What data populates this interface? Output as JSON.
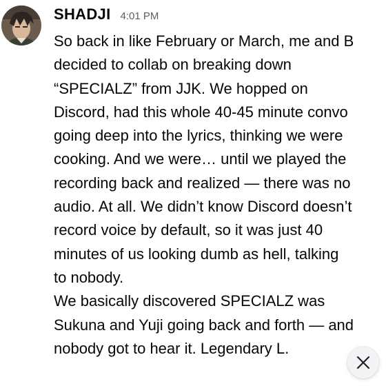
{
  "message": {
    "author": "SHADJI",
    "timestamp": "4:01 PM",
    "lines": [
      "So back in like February or March, me and B",
      "decided to collab on breaking down",
      "“SPECIALZ” from JJK. We hopped on",
      "Discord, had this whole 40-45 minute convo",
      "going deep into the lyrics, thinking we were",
      "cooking. And we were… until we played the",
      "recording back and realized — there was no",
      "audio. At all. We didn’t know Discord doesn’t",
      "record voice by default, so it was just 40",
      "minutes of us looking dumb as hell, talking",
      "to nobody.",
      "We basically discovered SPECIALZ was",
      "Sukuna and Yuji going back and forth — and",
      "nobody got to hear it. Legendary L."
    ]
  },
  "icons": {
    "avatar": "user-avatar",
    "close": "close-icon"
  },
  "colors": {
    "text": "#060607",
    "timestamp": "#5c5e66",
    "background": "#ffffff"
  }
}
